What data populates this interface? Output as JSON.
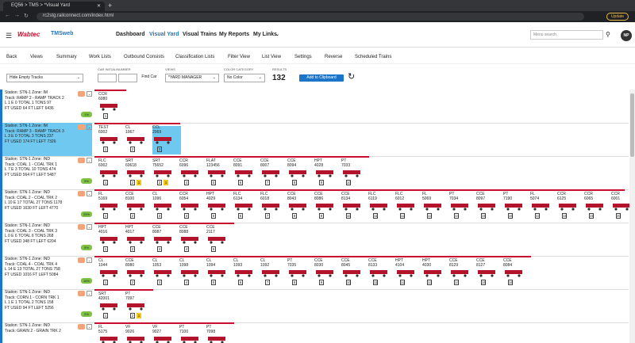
{
  "browser": {
    "tab_title": "EQ56 > TMS > *Visual Yard",
    "url": "rc2stg.railconnect.com/index.html",
    "update_label": "Update"
  },
  "app": {
    "logo": "Wabtec",
    "logo_sub": "TMSweb",
    "nav": [
      "Dashboard",
      "Visual Yard",
      "Visual Trains",
      "My Reports",
      "My Links"
    ],
    "menu_search_placeholder": "Menu search",
    "avatar": "NP"
  },
  "toolbar": [
    "Back",
    "Views",
    "Summary",
    "Work Lists",
    "Outbound Consists",
    "Classification Lists",
    "Filter View",
    "List View",
    "Settings",
    "Reverse",
    "Scheduled Trains"
  ],
  "controls": {
    "filter_select": "Hide Empty Tracks",
    "car_label": "CAR INITIAL/NUMBER",
    "find_car": "Find Car",
    "views_label": "VIEWS",
    "views_value": "*YARD MANAGER",
    "color_label": "COLOR CATEGORY",
    "color_value": "No Color",
    "results_label": "RESULTS",
    "results_value": "132",
    "clipboard": "Add to Clipboard"
  },
  "tracks": [
    {
      "station": "Station: STN-1 Zone: IM",
      "track": "Track: RAMP 2 - RAMP TRACK 2",
      "stats": "L 1   E 0   TOTAL 1   TONS 97",
      "ft": "FT USED 64   FT LEFT 6436",
      "pct": "1%",
      "hl": false,
      "cars": [
        [
          "CCR",
          "6080",
          "1",
          0
        ]
      ]
    },
    {
      "station": "Station: STN-1 Zone: IM",
      "track": "Track: RAMP 3 - RAMP TRACK 3",
      "stats": "L 3   E 0   TOTAL 3   TONS 237",
      "ft": "FT USED 174   FT LEFT 7326",
      "pct": "",
      "hl": true,
      "cars": [
        [
          "TEST",
          "6002",
          "1",
          0
        ],
        [
          "CL",
          "1067",
          "2",
          0
        ],
        [
          "CCL",
          "2069",
          "3",
          0
        ]
      ]
    },
    {
      "station": "Station: STN-1 Zone: IND",
      "track": "Track: COAL 1 - COAL TRK 1",
      "stats": "L 7   E 3   TOTAL 10   TONS 474",
      "ft": "FT USED 564   FT LEFT 5487",
      "pct": "9%",
      "hl": false,
      "cars": [
        [
          "FLC",
          "6002",
          "1",
          0
        ],
        [
          "SRT",
          "60618",
          "2",
          1
        ],
        [
          "SRT",
          "75652",
          "3",
          1
        ],
        [
          "CCR",
          "6096",
          "4",
          0
        ],
        [
          "FLAT",
          "123456",
          "5",
          0
        ],
        [
          "CCE",
          "8091",
          "6",
          0
        ],
        [
          "CCE",
          "8007",
          "7",
          0
        ],
        [
          "CCE",
          "8094",
          "8",
          0
        ],
        [
          "HPT",
          "4028",
          "9",
          0
        ],
        [
          "PT",
          "7033",
          "10",
          0
        ]
      ]
    },
    {
      "station": "Station: STN-1 Zone: IND",
      "track": "Track: COAL 2 - COAL TRK 2",
      "stats": "L 10   E 17   TOTAL 27   TONS 1178",
      "ft": "FT USED 1630   FT LEFT 4770",
      "pct": "25%",
      "hl": false,
      "cars": [
        [
          "FL",
          "5169",
          "1",
          0
        ],
        [
          "CCE",
          "8100",
          "2",
          0
        ],
        [
          "CL",
          "1096",
          "3",
          0
        ],
        [
          "CCR",
          "6054",
          "4",
          0
        ],
        [
          "HPT",
          "4029",
          "5",
          0
        ],
        [
          "FLC",
          "6134",
          "6",
          0
        ],
        [
          "FLC",
          "6018",
          "7",
          0
        ],
        [
          "CCE",
          "8043",
          "8",
          0
        ],
        [
          "CCE",
          "8086",
          "9",
          0
        ],
        [
          "CCE",
          "8134",
          "10",
          0
        ],
        [
          "FLC",
          "6119",
          "11",
          0
        ],
        [
          "FLC",
          "6012",
          "12",
          0
        ],
        [
          "FL",
          "5069",
          "13",
          0
        ],
        [
          "PT",
          "7034",
          "14",
          0
        ],
        [
          "CCE",
          "8097",
          "15",
          0
        ],
        [
          "PT",
          "7190",
          "16",
          0
        ],
        [
          "FL",
          "5074",
          "17",
          0
        ],
        [
          "CCR",
          "6125",
          "18",
          0
        ],
        [
          "CCR",
          "6065",
          "19",
          0
        ],
        [
          "CCR",
          "6001",
          "20",
          0
        ]
      ]
    },
    {
      "station": "Station: STN-1 Zone: IND",
      "track": "Track: COAL 3 - COAL TRK 3",
      "stats": "L 0   E 6   TOTAL 6   TONS 268",
      "ft": "FT USED 348   FT LEFT 6204",
      "pct": "5%",
      "hl": false,
      "cars": [
        [
          "HPT",
          "4016",
          "1",
          0
        ],
        [
          "HPT",
          "4017",
          "2",
          0
        ],
        [
          "CCE",
          "8087",
          "3",
          0
        ],
        [
          "CCE",
          "8088",
          "4",
          0
        ],
        [
          "CCE",
          "2117",
          "5",
          0
        ]
      ]
    },
    {
      "station": "Station: STN-1 Zone: IND",
      "track": "Track: COAL 4 - COAL TRK 4",
      "stats": "L 14   E 13   TOTAL 27   TONS 758",
      "ft": "FT USED 1016   FT LEFT 5084",
      "pct": "16%",
      "hl": false,
      "cars": [
        [
          "CL",
          "1044",
          "1",
          0
        ],
        [
          "CCE",
          "8080",
          "2",
          0
        ],
        [
          "CL",
          "1053",
          "3",
          0
        ],
        [
          "CL",
          "1098",
          "4",
          0
        ],
        [
          "CL",
          "1094",
          "5",
          0
        ],
        [
          "CL",
          "1093",
          "6",
          0
        ],
        [
          "CL",
          "1092",
          "7",
          0
        ],
        [
          "PT",
          "7035",
          "8",
          0
        ],
        [
          "CCE",
          "8030",
          "9",
          0
        ],
        [
          "CCE",
          "8045",
          "10",
          0
        ],
        [
          "CCE",
          "8133",
          "11",
          0
        ],
        [
          "HPT",
          "4104",
          "12",
          0
        ],
        [
          "HPT",
          "4030",
          "13",
          0
        ],
        [
          "CCE",
          "8129",
          "14",
          0
        ],
        [
          "CCE",
          "8127",
          "15",
          0
        ],
        [
          "CCE",
          "8084",
          "16",
          0
        ]
      ]
    },
    {
      "station": "Station: STN-1 Zone: IND",
      "track": "Track: CORN 1 - CORN TRK 1",
      "stats": "L 1   E 1   TOTAL 2   TONS 158",
      "ft": "FT USED 94   FT LEFT 5256",
      "pct": "2%",
      "hl": false,
      "cars": [
        [
          "SRT",
          "42001",
          "1",
          0
        ],
        [
          "PT",
          "7097",
          "2",
          1
        ]
      ]
    },
    {
      "station": "Station: STN-1 Zone: IND",
      "track": "Track: GRAIN 2 - GRAIN TRK 2",
      "stats": "",
      "ft": "",
      "pct": "",
      "hl": false,
      "cars": [
        [
          "FL",
          "5175",
          "1",
          0
        ],
        [
          "VF",
          "9026",
          "2",
          0
        ],
        [
          "VF",
          "9027",
          "3",
          0
        ],
        [
          "PT",
          "7100",
          "4",
          0
        ],
        [
          "PT",
          "7098",
          "5",
          0
        ]
      ]
    }
  ]
}
